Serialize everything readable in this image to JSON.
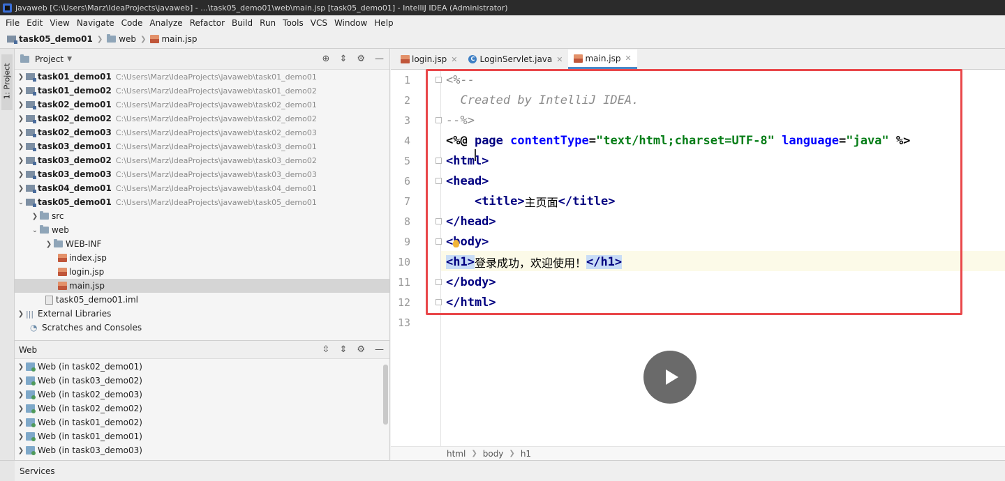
{
  "window": {
    "title": "javaweb [C:\\Users\\Marz\\IdeaProjects\\javaweb] - ...\\task05_demo01\\web\\main.jsp [task05_demo01] - IntelliJ IDEA (Administrator)"
  },
  "menu": [
    "File",
    "Edit",
    "View",
    "Navigate",
    "Code",
    "Analyze",
    "Refactor",
    "Build",
    "Run",
    "Tools",
    "VCS",
    "Window",
    "Help"
  ],
  "breadcrumb": {
    "module": "task05_demo01",
    "folder": "web",
    "file": "main.jsp"
  },
  "left_strip": {
    "project_tab": "1: Project"
  },
  "project_panel": {
    "title": "Project",
    "modules": [
      {
        "name": "task01_demo01",
        "path": "C:\\Users\\Marz\\IdeaProjects\\javaweb\\task01_demo01"
      },
      {
        "name": "task01_demo02",
        "path": "C:\\Users\\Marz\\IdeaProjects\\javaweb\\task01_demo02"
      },
      {
        "name": "task02_demo01",
        "path": "C:\\Users\\Marz\\IdeaProjects\\javaweb\\task02_demo01"
      },
      {
        "name": "task02_demo02",
        "path": "C:\\Users\\Marz\\IdeaProjects\\javaweb\\task02_demo02"
      },
      {
        "name": "task02_demo03",
        "path": "C:\\Users\\Marz\\IdeaProjects\\javaweb\\task02_demo03"
      },
      {
        "name": "task03_demo01",
        "path": "C:\\Users\\Marz\\IdeaProjects\\javaweb\\task03_demo01"
      },
      {
        "name": "task03_demo02",
        "path": "C:\\Users\\Marz\\IdeaProjects\\javaweb\\task03_demo02"
      },
      {
        "name": "task03_demo03",
        "path": "C:\\Users\\Marz\\IdeaProjects\\javaweb\\task03_demo03"
      },
      {
        "name": "task04_demo01",
        "path": "C:\\Users\\Marz\\IdeaProjects\\javaweb\\task04_demo01"
      },
      {
        "name": "task05_demo01",
        "path": "C:\\Users\\Marz\\IdeaProjects\\javaweb\\task05_demo01"
      }
    ],
    "children": {
      "src": "src",
      "web": "web",
      "web_inf": "WEB-INF",
      "index": "index.jsp",
      "login": "login.jsp",
      "main": "main.jsp",
      "iml": "task05_demo01.iml"
    },
    "external_libraries": "External Libraries",
    "scratches": "Scratches and Consoles"
  },
  "web_panel": {
    "title": "Web",
    "items": [
      "Web (in task02_demo01)",
      "Web (in task03_demo02)",
      "Web (in task02_demo03)",
      "Web (in task02_demo02)",
      "Web (in task01_demo02)",
      "Web (in task01_demo01)",
      "Web (in task03_demo03)"
    ]
  },
  "services": {
    "label": "Services"
  },
  "editor": {
    "tabs": [
      {
        "label": "login.jsp",
        "kind": "jsp"
      },
      {
        "label": "LoginServlet.java",
        "kind": "class"
      },
      {
        "label": "main.jsp",
        "kind": "jsp",
        "active": true
      }
    ],
    "line_numbers": [
      "1",
      "2",
      "3",
      "4",
      "5",
      "6",
      "7",
      "8",
      "9",
      "10",
      "11",
      "12",
      "13"
    ],
    "code": {
      "l1": "<%--",
      "l2": "  Created by IntelliJ IDEA.",
      "l3": "--%>",
      "l4_open": "<%@ ",
      "l4_page": "page ",
      "l4_attr1": "contentType",
      "l4_eq1": "=",
      "l4_val1": "\"text/html;charset=UTF-8\"",
      "l4_attr2": " language",
      "l4_eq2": "=",
      "l4_val2": "\"java\"",
      "l4_close": " %>",
      "l5": "<html>",
      "l6": "<head>",
      "l7_indent": "    ",
      "l7_open": "<title>",
      "l7_text": "主页面",
      "l7_close": "</title>",
      "l8": "</head>",
      "l9": "<body>",
      "l10_open": "<h1>",
      "l10_text": "登录成功，欢迎使用！",
      "l10_close": "</h1>",
      "l11": "</body>",
      "l12": "</html>"
    },
    "status_breadcrumb": [
      "html",
      "body",
      "h1"
    ]
  }
}
